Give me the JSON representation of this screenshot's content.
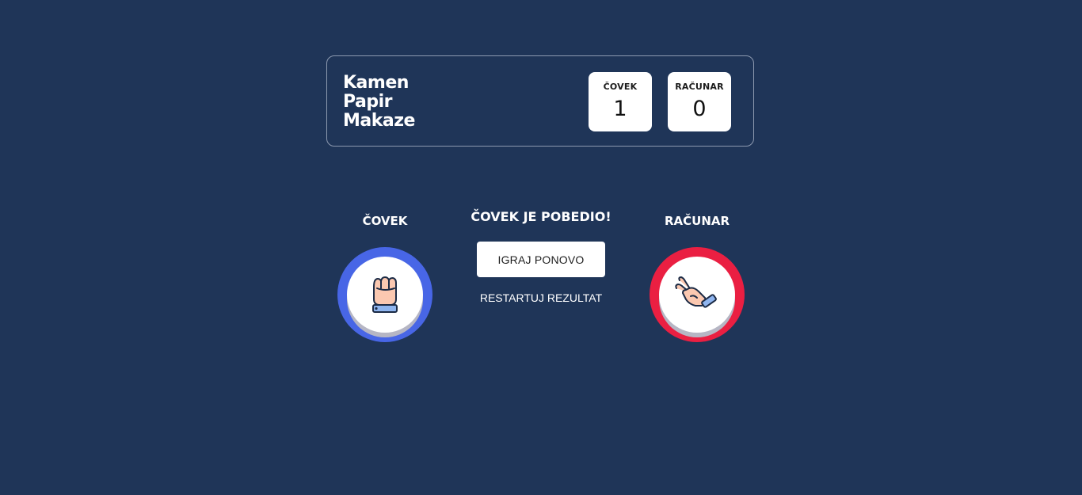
{
  "header": {
    "title_lines": [
      "Kamen",
      "Papir",
      "Makaze"
    ]
  },
  "scores": {
    "human": {
      "label": "ČOVEK",
      "value": "1"
    },
    "computer": {
      "label": "RAČUNAR",
      "value": "0"
    }
  },
  "players": {
    "human": {
      "label": "ČOVEK",
      "choice_icon": "rock-fist-icon",
      "ring_color": "#4866e6"
    },
    "computer": {
      "label": "RAČUNAR",
      "choice_icon": "scissors-hand-icon",
      "ring_color": "#ea1f42"
    }
  },
  "result": {
    "message": "ČOVEK JE POBEDIO!",
    "play_again_label": "IGRAJ PONOVO",
    "reset_label": "RESTARTUJ REZULTAT"
  },
  "colors": {
    "background": "#1f3558",
    "human_accent": "#4866e6",
    "computer_accent": "#ea1f42"
  }
}
